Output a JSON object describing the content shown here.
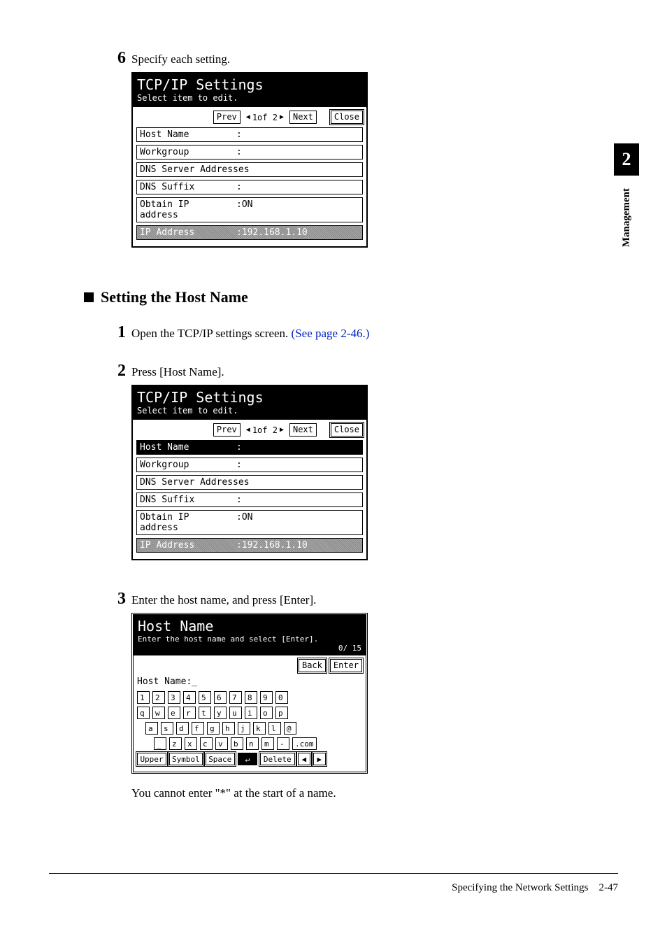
{
  "chapter": {
    "number": "2",
    "label": "Management"
  },
  "step6": {
    "num": "6",
    "text": "Specify each setting."
  },
  "lcd1": {
    "title": "TCP/IP Settings",
    "subtitle": "Select item to edit.",
    "nav": {
      "prev": "Prev",
      "pager": "1of 2",
      "next": "Next",
      "close": "Close"
    },
    "rows": [
      {
        "label": "Host Name",
        "value": ":"
      },
      {
        "label": "Workgroup",
        "value": ":"
      },
      {
        "label": "DNS Server Addresses",
        "value": "",
        "full": true
      },
      {
        "label": "DNS Suffix",
        "value": ":"
      },
      {
        "label": "Obtain IP address",
        "value": ":ON"
      },
      {
        "label": "IP Address",
        "value": ":192.168.1.10",
        "dimmed": true
      }
    ]
  },
  "sectionHost": "Setting the Host Name",
  "step1": {
    "num": "1",
    "text": "Open the TCP/IP settings screen. ",
    "link": "(See page 2-46.)"
  },
  "step2": {
    "num": "2",
    "text": "Press [Host Name]."
  },
  "lcd2": {
    "title": "TCP/IP Settings",
    "subtitle": "Select item to edit.",
    "nav": {
      "prev": "Prev",
      "pager": "1of 2",
      "next": "Next",
      "close": "Close"
    },
    "rows": [
      {
        "label": "Host Name",
        "value": ":",
        "selected": true
      },
      {
        "label": "Workgroup",
        "value": ":"
      },
      {
        "label": "DNS Server Addresses",
        "value": "",
        "full": true
      },
      {
        "label": "DNS Suffix",
        "value": ":"
      },
      {
        "label": "Obtain IP address",
        "value": ":ON"
      },
      {
        "label": "IP Address",
        "value": ":192.168.1.10",
        "dimmed": true
      }
    ]
  },
  "step3": {
    "num": "3",
    "text": "Enter the host name, and press [Enter]."
  },
  "lcd3": {
    "title": "Host Name",
    "subtitle": "Enter the host name and select [Enter].",
    "counter": "0/ 15",
    "back": "Back",
    "enter": "Enter",
    "hostline": "Host Name:_",
    "row1": [
      "1",
      "2",
      "3",
      "4",
      "5",
      "6",
      "7",
      "8",
      "9",
      "0"
    ],
    "row2": [
      "q",
      "w",
      "e",
      "r",
      "t",
      "y",
      "u",
      "i",
      "o",
      "p"
    ],
    "row3": [
      "a",
      "s",
      "d",
      "f",
      "g",
      "h",
      "j",
      "k",
      "l",
      "@"
    ],
    "row4": [
      "_",
      "z",
      "x",
      "c",
      "v",
      "b",
      "n",
      "m",
      "-"
    ],
    "com": ".com",
    "bottom": {
      "upper": "Upper",
      "symbol": "Symbol",
      "space": "Space",
      "enterIcon": "↵",
      "delete": "Delete",
      "left": "◀",
      "right": "▶"
    }
  },
  "note": "You cannot enter \"*\" at the start of a name.",
  "footer": {
    "text": "Specifying the Network Settings",
    "page": "2-47"
  }
}
